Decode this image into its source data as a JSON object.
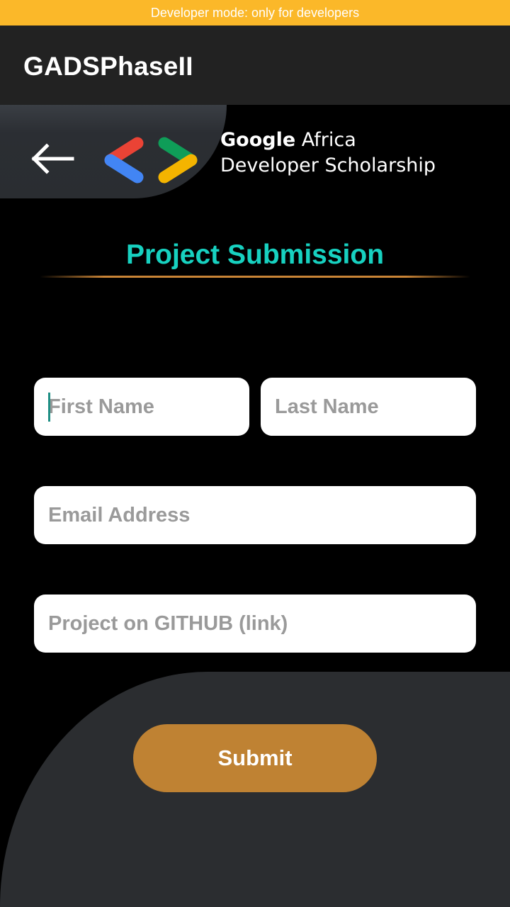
{
  "status_banner": {
    "text": "Developer mode: only for developers"
  },
  "app_bar": {
    "title": "GADSPhaseII"
  },
  "header": {
    "back_icon": "arrow-left-icon",
    "logo_icon": "gads-chevrons-logo",
    "brand_line1_bold": "Google",
    "brand_line1_rest": " Africa",
    "brand_line2": "Developer Scholarship"
  },
  "page": {
    "title": "Project Submission"
  },
  "form": {
    "first_name": {
      "value": "",
      "placeholder": "First Name"
    },
    "last_name": {
      "value": "",
      "placeholder": "Last Name"
    },
    "email": {
      "value": "",
      "placeholder": "Email Address"
    },
    "github": {
      "value": "",
      "placeholder": "Project on GITHUB (link)"
    },
    "submit_label": "Submit"
  },
  "colors": {
    "banner": "#FBB829",
    "app_bar": "#222222",
    "title_accent": "#17D1C0",
    "underline": "#C98436",
    "submit": "#BF8233",
    "panel": "#2B2D30"
  }
}
